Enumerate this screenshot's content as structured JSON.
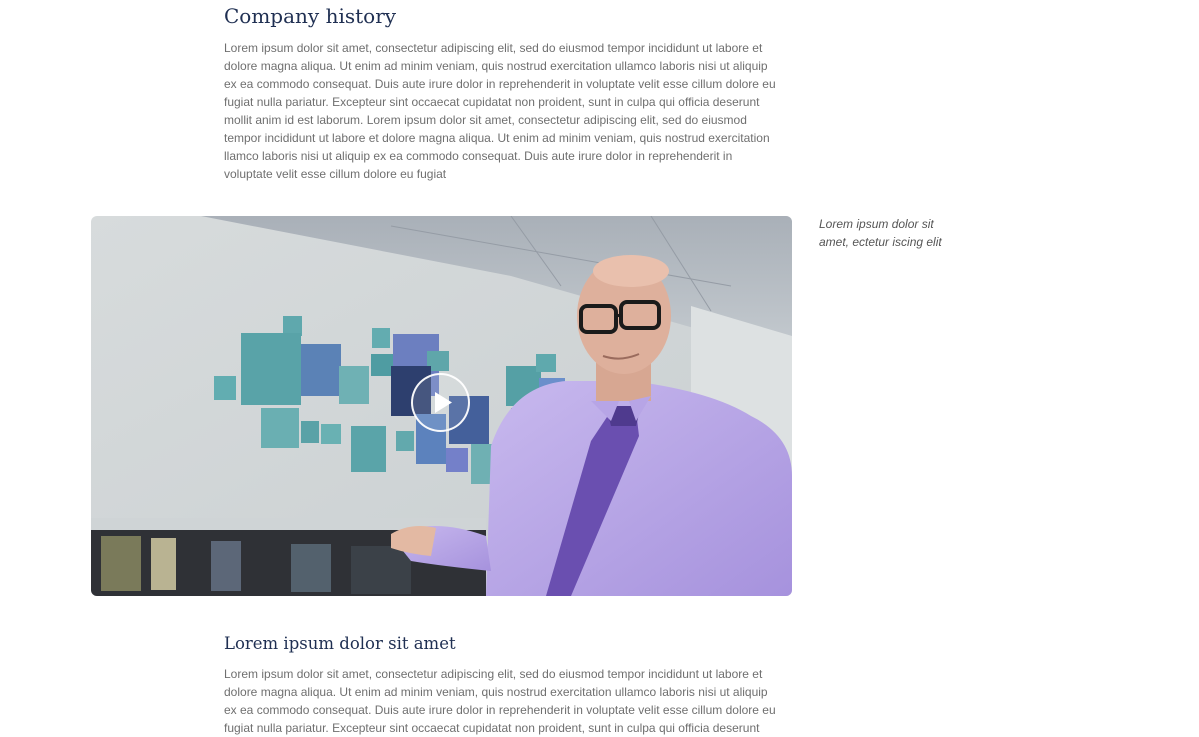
{
  "section_history": {
    "title": "Company history",
    "body": "Lorem ipsum dolor sit amet, consectetur adipiscing elit, sed do eiusmod tempor incididunt ut labore et dolore magna aliqua. Ut enim ad minim veniam, quis nostrud exercitation ullamco laboris nisi ut aliquip ex ea commodo consequat. Duis aute irure dolor in reprehenderit in voluptate velit esse cillum dolore eu fugiat nulla pariatur. Excepteur sint occaecat cupidatat non proident, sunt in culpa qui officia deserunt mollit anim id est laborum. Lorem ipsum dolor sit amet, consectetur adipiscing elit, sed do eiusmod tempor incididunt ut labore et dolore magna aliqua. Ut enim ad minim veniam, quis nostrud exercitation llamco laboris nisi ut aliquip ex ea commodo consequat. Duis aute irure dolor in reprehenderit in voluptate velit esse cillum dolore eu fugiat"
  },
  "video": {
    "play_icon": "play-icon",
    "caption": "Lorem ipsum dolor sit amet, ectetur iscing elit"
  },
  "section_second": {
    "title": "Lorem ipsum dolor sit amet",
    "body": "Lorem ipsum dolor sit amet, consectetur adipiscing elit, sed do eiusmod tempor incididunt ut labore et dolore magna aliqua. Ut enim ad minim veniam, quis nostrud exercitation ullamco laboris nisi ut aliquip ex ea commodo consequat. Duis aute irure dolor in reprehenderit in voluptate velit esse cillum dolore eu fugiat nulla pariatur. Excepteur sint occaecat cupidatat non proident, sunt in culpa qui officia deserunt"
  },
  "colors": {
    "heading": "#1f2f52",
    "body_text": "#6f6f6f",
    "caption_text": "#555555",
    "shirt": "#b9a7e6",
    "tie": "#6a4fb0"
  }
}
